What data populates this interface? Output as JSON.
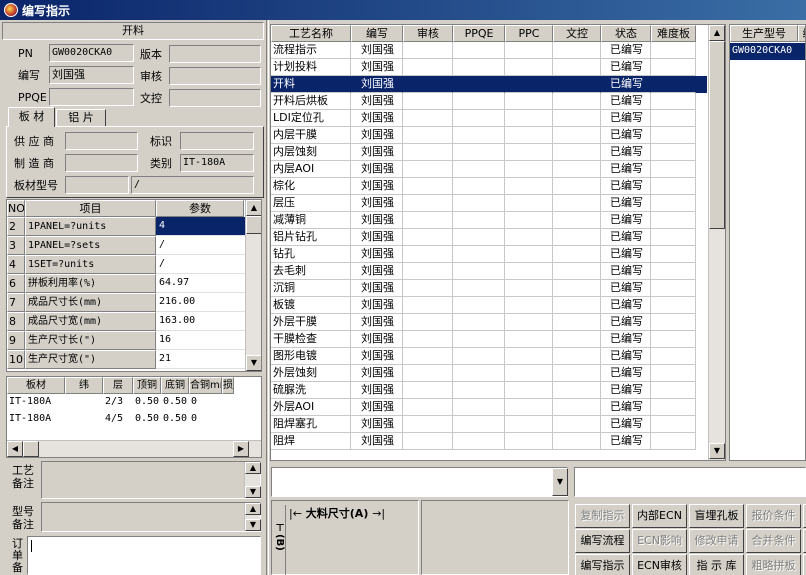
{
  "window": {
    "title": "编写指示"
  },
  "left": {
    "section_title": "开料",
    "pn_label": "PN",
    "pn_value": "GW0020CKA0",
    "version_label": "版本",
    "version_value": "",
    "author_label": "编写",
    "author_value": "刘国强",
    "review_label": "审核",
    "review_value": "",
    "ppqe_label": "PPQE",
    "ppqe_value": "",
    "doc_label": "文控",
    "doc_value": "",
    "tabs": [
      "板 材",
      "铝 片"
    ],
    "supplier_label": "供 应 商",
    "supplier_value": "",
    "mark_label": "标识",
    "mark_value": "",
    "maker_label": "制 造 商",
    "maker_value": "",
    "category_label": "类别",
    "category_value": "IT-180A",
    "board_model_label": "板材型号",
    "board_model_value": "",
    "board_model_value2": "/",
    "param_table": {
      "headers": [
        "NO",
        "项目",
        "参数"
      ],
      "rows": [
        [
          "2",
          "1PANEL=?units",
          "4"
        ],
        [
          "3",
          "1PANEL=?sets",
          "/"
        ],
        [
          "4",
          "1SET=?units",
          "/"
        ],
        [
          "6",
          "拼板利用率(%)",
          "64.97"
        ],
        [
          "7",
          "成品尺寸长(mm)",
          "216.00"
        ],
        [
          "8",
          "成品尺寸宽(mm)",
          "163.00"
        ],
        [
          "9",
          "生产尺寸长(\")",
          "16"
        ],
        [
          "10",
          "生产尺寸宽(\")",
          "21"
        ]
      ]
    },
    "material_table": {
      "headers": [
        "板材",
        "纬",
        "层",
        "顶铜",
        "底铜",
        "合铜mm",
        "损"
      ],
      "rows": [
        [
          "IT-180A",
          "",
          "2/3",
          "0.50",
          "0.50",
          "0"
        ],
        [
          "IT-180A",
          "",
          "4/5",
          "0.50",
          "0.50",
          "0"
        ]
      ]
    },
    "process_note_label": "工艺\n备注",
    "model_note_label": "型号\n备注",
    "order_note_label": "订\n单\n备"
  },
  "process_table": {
    "headers": [
      "工艺名称",
      "编写",
      "审核",
      "PPQE",
      "PPC",
      "文控",
      "状态",
      "难度板"
    ],
    "selected_index": 2,
    "rows": [
      [
        "流程指示",
        "刘国强",
        "已编写"
      ],
      [
        "计划投料",
        "刘国强",
        "已编写"
      ],
      [
        "开料",
        "刘国强",
        "已编写"
      ],
      [
        "开料后烘板",
        "刘国强",
        "已编写"
      ],
      [
        "LDI定位孔",
        "刘国强",
        "已编写"
      ],
      [
        "内层干膜",
        "刘国强",
        "已编写"
      ],
      [
        "内层蚀刻",
        "刘国强",
        "已编写"
      ],
      [
        "内层AOI",
        "刘国强",
        "已编写"
      ],
      [
        "棕化",
        "刘国强",
        "已编写"
      ],
      [
        "层压",
        "刘国强",
        "已编写"
      ],
      [
        "减薄铜",
        "刘国强",
        "已编写"
      ],
      [
        "铝片钻孔",
        "刘国强",
        "已编写"
      ],
      [
        "钻孔",
        "刘国强",
        "已编写"
      ],
      [
        "去毛刺",
        "刘国强",
        "已编写"
      ],
      [
        "沉铜",
        "刘国强",
        "已编写"
      ],
      [
        "板镀",
        "刘国强",
        "已编写"
      ],
      [
        "外层干膜",
        "刘国强",
        "已编写"
      ],
      [
        "干膜检查",
        "刘国强",
        "已编写"
      ],
      [
        "图形电镀",
        "刘国强",
        "已编写"
      ],
      [
        "外层蚀刻",
        "刘国强",
        "已编写"
      ],
      [
        "硫脲洗",
        "刘国强",
        "已编写"
      ],
      [
        "外层AOI",
        "刘国强",
        "已编写"
      ],
      [
        "阻焊塞孔",
        "刘国强",
        "已编写"
      ],
      [
        "阻焊",
        "刘国强",
        "已编写"
      ]
    ]
  },
  "model_table": {
    "headers": [
      "生产型号",
      "编"
    ],
    "rows": [
      "GW0020CKA0"
    ]
  },
  "diagram": {
    "a_label": "大料尺寸(A)",
    "b_label": "(B)"
  },
  "toolbar": {
    "rows": [
      [
        {
          "label": "复制指示",
          "enabled": false
        },
        {
          "label": "内部ECN",
          "enabled": true
        },
        {
          "label": "盲埋孔板",
          "enabled": true
        },
        {
          "label": "报价条件",
          "enabled": false
        },
        {
          "label": "指",
          "enabled": true
        }
      ],
      [
        {
          "label": "编写流程",
          "enabled": true
        },
        {
          "label": "ECN影响",
          "enabled": false
        },
        {
          "label": "修改申请",
          "enabled": false
        },
        {
          "label": "合并条件",
          "enabled": false
        },
        {
          "label": "回",
          "enabled": false
        }
      ],
      [
        {
          "label": "编写指示",
          "enabled": true
        },
        {
          "label": "ECN审核",
          "enabled": true
        },
        {
          "label": "指 示 库",
          "enabled": true
        },
        {
          "label": "粗略拼板",
          "enabled": false
        },
        {
          "label": "光",
          "enabled": true
        }
      ]
    ]
  },
  "colors": {
    "title_start": "#0a246a",
    "selection": "#0a246a",
    "face": "#d4d0c8"
  }
}
